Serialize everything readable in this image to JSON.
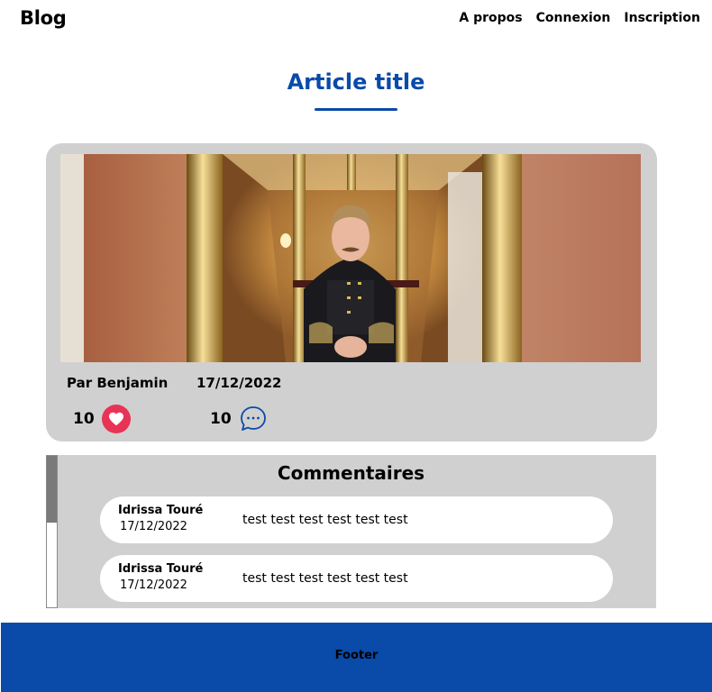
{
  "header": {
    "logo": "Blog",
    "nav": [
      "A propos",
      "Connexion",
      "Inscription"
    ]
  },
  "article": {
    "title": "Article title",
    "author": "Par Benjamin",
    "date": "17/12/2022",
    "likes": "10",
    "comments_count": "10"
  },
  "comments": {
    "title": "Commentaires",
    "items": [
      {
        "author": "Idrissa Touré",
        "date": "17/12/2022",
        "text": "test test test test test test"
      },
      {
        "author": "Idrissa Touré",
        "date": "17/12/2022",
        "text": "test test test test test test"
      }
    ]
  },
  "footer": {
    "text": "Footer"
  },
  "colors": {
    "accent": "#0a4aa8",
    "card_bg": "#d0d0d0",
    "heart": "#e83356"
  },
  "icons": {
    "like": "heart-icon",
    "comment": "comment-bubble-icon"
  }
}
